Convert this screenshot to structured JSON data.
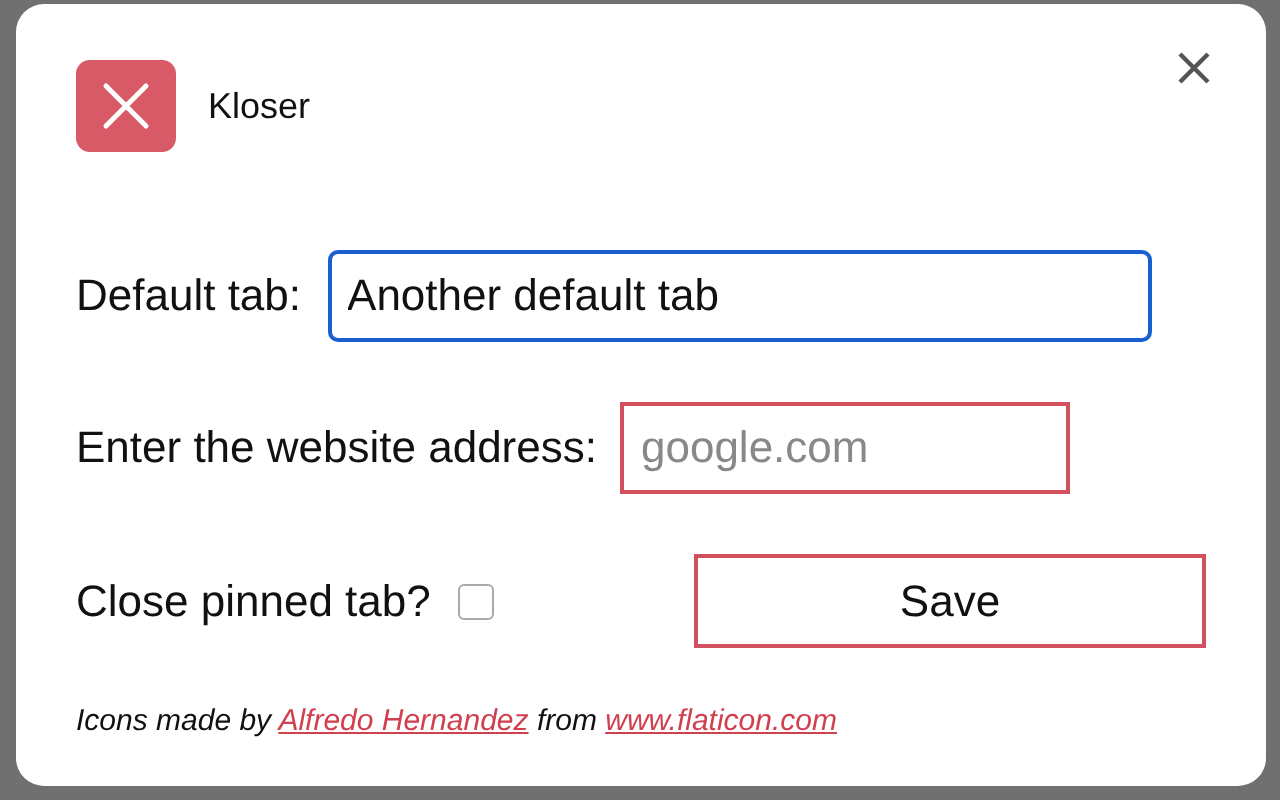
{
  "app": {
    "title": "Kloser"
  },
  "default_tab": {
    "label": "Default tab:",
    "value": "Another default tab",
    "focused": true
  },
  "website": {
    "label": "Enter the website address:",
    "placeholder": "google.com"
  },
  "close_pinned": {
    "label": "Close pinned tab?",
    "checked": false
  },
  "save_button": {
    "label": "Save"
  },
  "credits": {
    "before": "Icons made by",
    "author": "Alfredo Hernandez",
    "middle": "from",
    "site": "www.flaticon.com"
  }
}
